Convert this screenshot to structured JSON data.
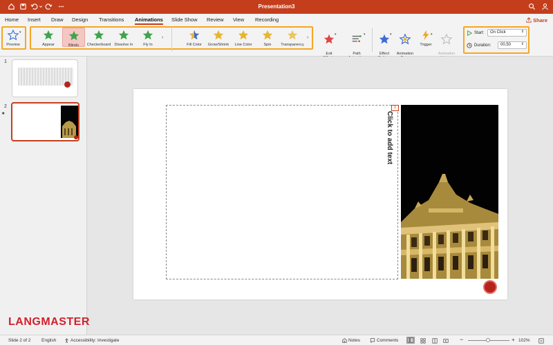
{
  "titlebar": {
    "title": "Presentation3",
    "bg_color": "#c43e1c"
  },
  "menu": {
    "tabs": [
      "Home",
      "Insert",
      "Draw",
      "Design",
      "Transitions",
      "Animations",
      "Slide Show",
      "Review",
      "View",
      "Recording"
    ],
    "active": "Animations",
    "share_label": "Share"
  },
  "ribbon": {
    "preview_label": "Preview",
    "entrance_effects": [
      {
        "label": "Appear",
        "color": "#3fa34d"
      },
      {
        "label": "Blinds",
        "color": "#3fa34d",
        "selected": true
      },
      {
        "label": "Checkerboard",
        "color": "#3fa34d"
      },
      {
        "label": "Dissolve In",
        "color": "#3fa34d"
      },
      {
        "label": "Fly In",
        "color": "#3fa34d"
      }
    ],
    "emphasis_effects": [
      {
        "label": "Fill Color",
        "color": "#e8b530"
      },
      {
        "label": "Grow/Shrink",
        "color": "#e8b530"
      },
      {
        "label": "Line Color",
        "color": "#e8b530"
      },
      {
        "label": "Spin",
        "color": "#e8b530"
      },
      {
        "label": "Transparency",
        "color": "#e8b530"
      }
    ],
    "exit_effects_label": "Exit\nEffects",
    "path_animation_label": "Path\nAnimation",
    "effect_options_label": "Effect\nOptions",
    "animation_pane_label": "Animation\nPane",
    "trigger_label": "Trigger",
    "animation_painter_label": "Animation\nPainter",
    "start_label": "Start:",
    "start_value": "On Click",
    "duration_label": "Duration:",
    "duration_value": "00,50"
  },
  "slides": {
    "items": [
      {
        "number": "1"
      },
      {
        "number": "2"
      }
    ],
    "selected": 2
  },
  "slide": {
    "placeholder_text": "Click to add text",
    "anim_badge": "1"
  },
  "watermark": "LANGMASTER",
  "status": {
    "slide_info": "Slide 2 of 2",
    "language": "English",
    "accessibility": "Accessibility: Investigate",
    "notes": "Notes",
    "comments": "Comments",
    "zoom": "102%"
  }
}
